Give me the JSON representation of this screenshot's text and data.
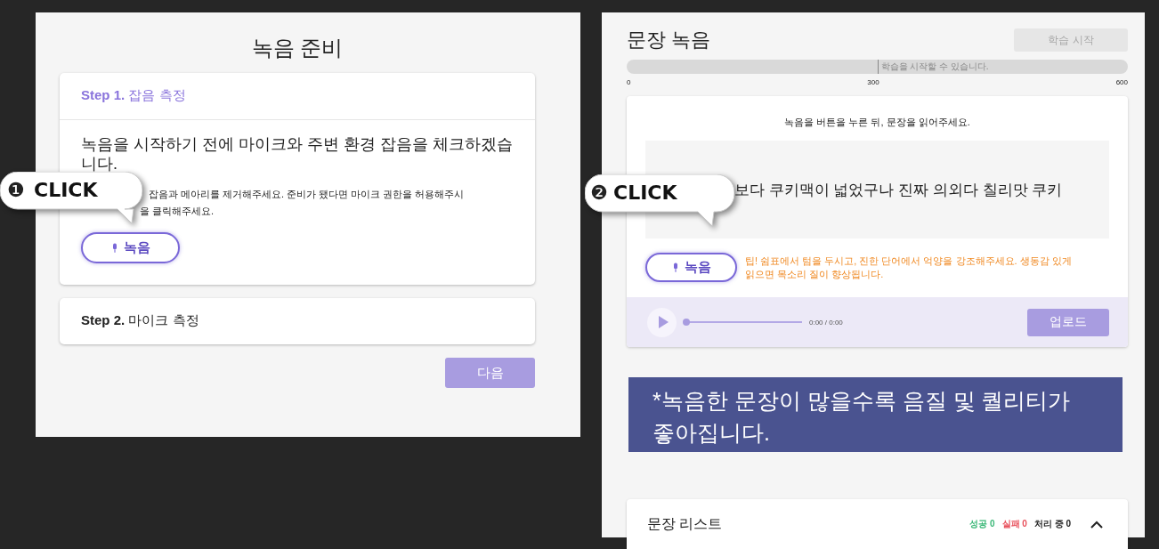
{
  "prep": {
    "title": "녹음 준비",
    "steps": [
      {
        "number": "Step 1.",
        "title": "잡음 측정",
        "selected": true,
        "expanded": true,
        "intro": "녹음을 시작하기 전에 마이크와 주변 환경 잡음을 체크하겠습니다.",
        "instruction_lines": [
          [
            "잡음과 메아리를 제거해주세요. 준비가 됐다면 마이크 권한을 허용해주시"
          ],
          [
            "을 클릭해주세요."
          ]
        ],
        "record_button": "녹음"
      },
      {
        "number": "Step 2.",
        "title": "마이크 측정",
        "selected": false,
        "expanded": false
      }
    ],
    "next_button": "다음"
  },
  "recording": {
    "title": "문장 녹음",
    "start_button": "학습 시작",
    "start_disabled": true,
    "progress": {
      "marker": "학습을 시작할 수 있습니다.",
      "ticks": [
        "0",
        "300",
        "600"
      ]
    },
    "instruction": "녹음을 버튼을 누른 뒤, 문장을 읽어주세요.",
    "sentence": "보다 쿠키맥이 넓었구나 진짜 의외다 칠리맛 쿠키",
    "record_button": "녹음",
    "tip": "팁! 쉼표에서 텀을 두시고, 진한 단어에서 억양을 강조해주세요. 생동감 있게 읽으면 목소리 질이 향상됩니다.",
    "player": {
      "level": 0,
      "time": "0:00 / 0:00"
    },
    "upload_button": "업로드"
  },
  "notice": [
    "*녹음한 문장이 많을수록 음질 및 퀄리티가",
    "좋아집니다."
  ],
  "sentence_list": {
    "title": "문장 리스트",
    "expanded": true,
    "counts": [
      {
        "label": "성공",
        "value": "0",
        "color": "#3cb878"
      },
      {
        "label": "실패",
        "value": "0",
        "color": "#e8505b"
      },
      {
        "label": "처리 중",
        "value": "0",
        "color": "#222222"
      }
    ]
  },
  "callouts": [
    {
      "number": "❶",
      "label": "CLICK"
    },
    {
      "number": "❷",
      "label": "CLICK"
    }
  ]
}
